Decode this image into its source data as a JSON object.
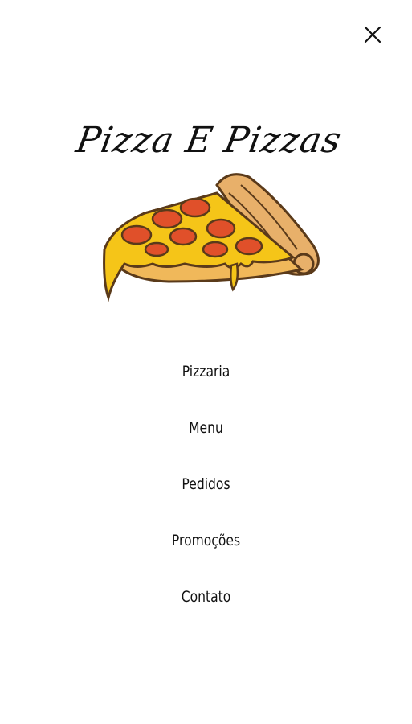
{
  "header": {
    "close_icon": "close-icon"
  },
  "logo": {
    "title": "Pizza E Pizzas",
    "image_icon": "pizza-slice-illustration"
  },
  "menu": {
    "items": [
      {
        "label": "Pizzaria"
      },
      {
        "label": "Menu"
      },
      {
        "label": "Pedidos"
      },
      {
        "label": "Promoções"
      },
      {
        "label": "Contato"
      }
    ]
  },
  "colors": {
    "background": "#ffffff",
    "text": "#111111",
    "cheese": "#f5c518",
    "pepperoni": "#e0502a",
    "crust": "#e8b06a"
  }
}
